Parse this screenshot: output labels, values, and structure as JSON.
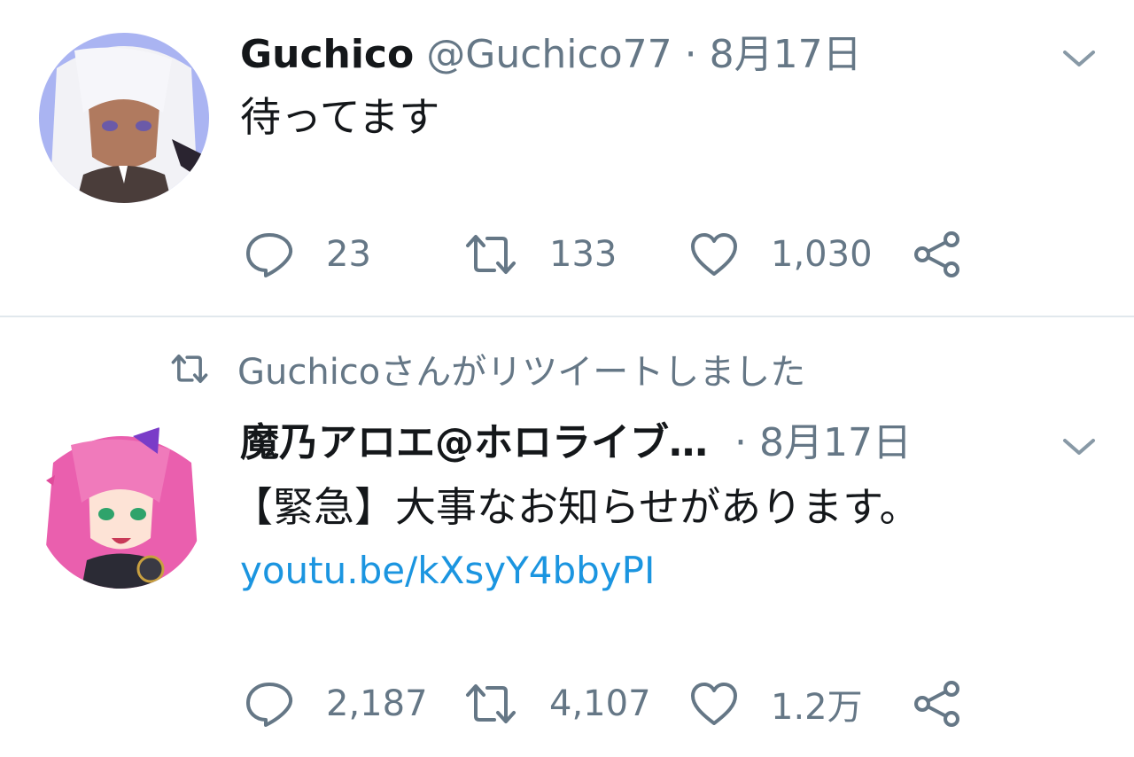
{
  "tweets": [
    {
      "display_name": "Guchico",
      "handle": "@Guchico77",
      "separator": "·",
      "date": "8月17日",
      "text": "待ってます",
      "replies": "23",
      "retweets": "133",
      "likes": "1,030",
      "avatar": {
        "icon": "anime-avatar",
        "bg": "#aab4f2",
        "hair": "#f2f2f6"
      }
    },
    {
      "retweet_context": "Guchicoさんがリツイートしました",
      "display_name": "魔乃アロエ@ホロライブ…",
      "separator": "·",
      "date": "8月17日",
      "text": "【緊急】大事なお知らせがあります。",
      "link": "youtu.be/kXsyY4bbyPI",
      "replies": "2,187",
      "retweets": "4,107",
      "likes": "1.2万",
      "avatar": {
        "icon": "anime-avatar",
        "bg": "#ffffff",
        "hair": "#ea5fae"
      }
    }
  ],
  "icons": {
    "reply": "speech-bubble-icon",
    "retweet": "retweet-icon",
    "like": "heart-icon",
    "share": "share-icon",
    "menu": "chevron-down-icon"
  },
  "colors": {
    "text": "#14171a",
    "secondary": "#657786",
    "link": "#1b95e0",
    "divider": "#e1e8ed"
  }
}
